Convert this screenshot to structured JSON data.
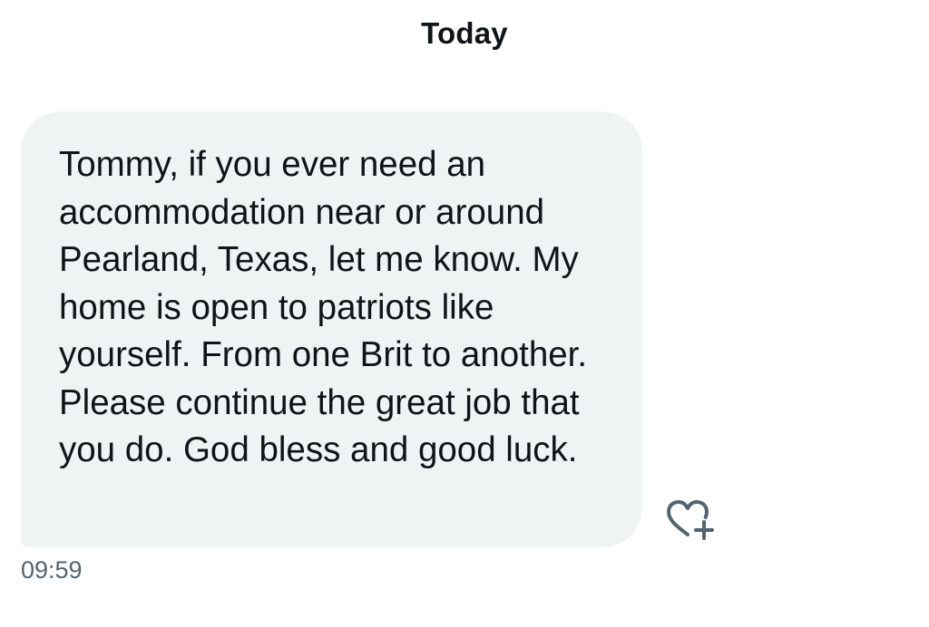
{
  "conversation": {
    "date_divider": "Today"
  },
  "message": {
    "text": "Tommy, if you ever need an accommodation near or around Pearland, Texas, let me know. My home is open to patriots like yourself. From one Brit to another. Please continue the great job that you do. God bless and good luck.",
    "time": "09:59",
    "bubble_color": "#eff3f4"
  },
  "actions": {
    "react_icon": "heart-plus-icon"
  }
}
